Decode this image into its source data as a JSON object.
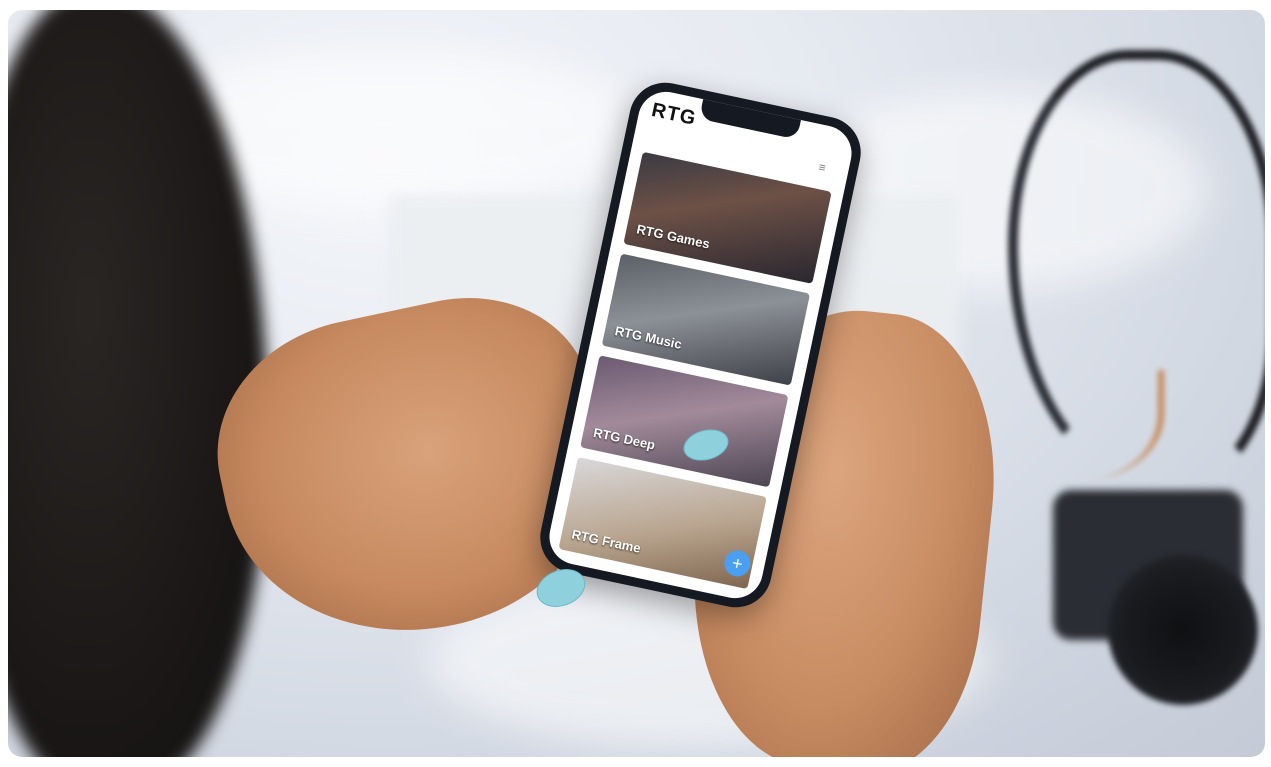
{
  "phone_app": {
    "brand": "RTG",
    "cards": [
      {
        "label": "RTG Games"
      },
      {
        "label": "RTG Music"
      },
      {
        "label": "RTG Deep"
      },
      {
        "label": "RTG Frame"
      }
    ],
    "fab_symbol": "+",
    "menu_symbol": "≡"
  },
  "colors": {
    "fab": "#4a9ff0",
    "nail_polish": "#8fd0dd"
  },
  "icons": [
    "menu-icon",
    "plus-icon"
  ]
}
